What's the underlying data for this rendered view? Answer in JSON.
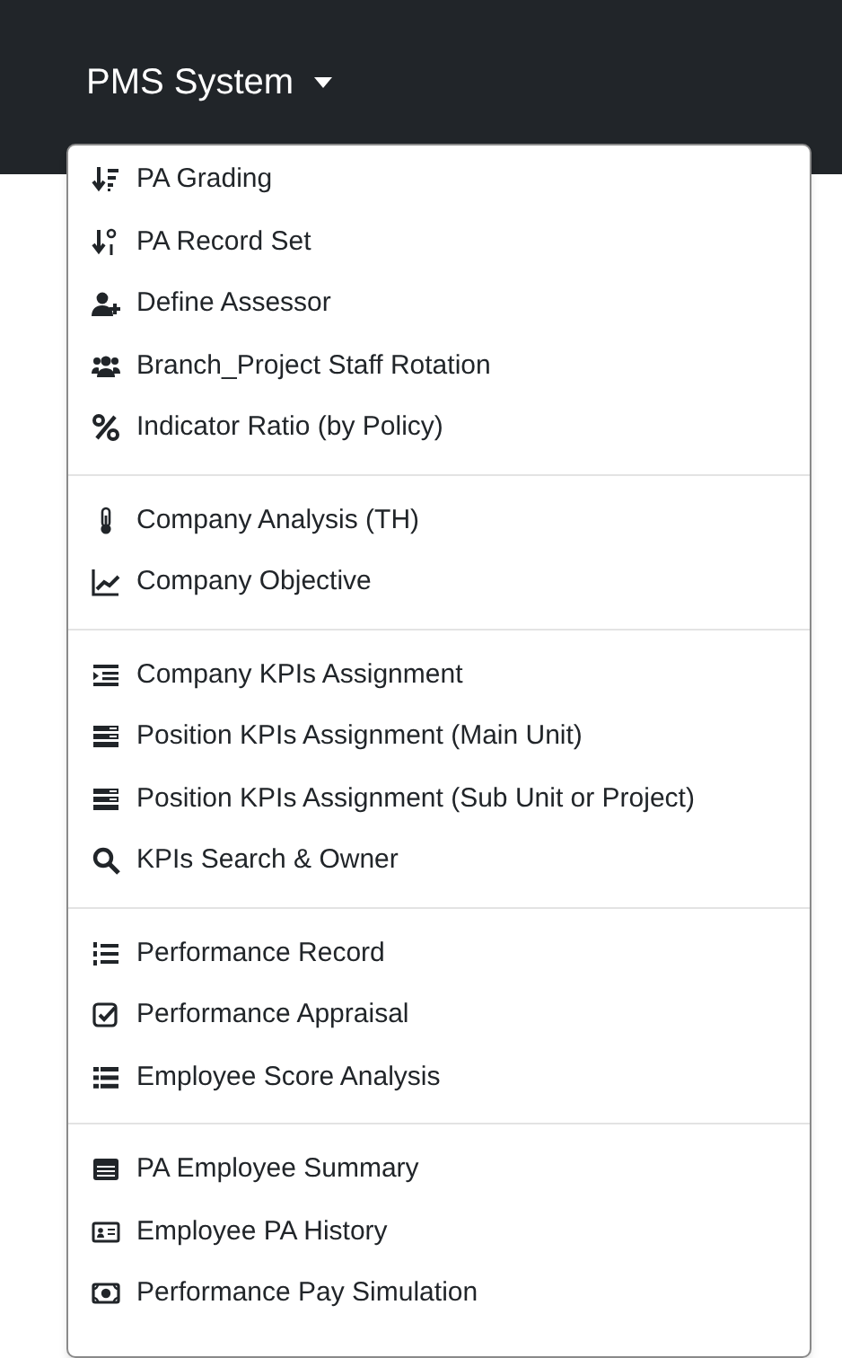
{
  "navbar": {
    "brand": "PMS System"
  },
  "menu": {
    "groups": [
      {
        "items": [
          "PA Grading",
          "PA Record Set",
          "Define Assessor",
          "Branch_Project Staff Rotation",
          "Indicator Ratio (by Policy)"
        ]
      },
      {
        "items": [
          "Company Analysis (TH)",
          "Company Objective"
        ]
      },
      {
        "items": [
          "Company KPIs Assignment",
          "Position KPIs Assignment (Main Unit)",
          "Position KPIs Assignment (Sub Unit or Project)",
          "KPIs Search & Owner"
        ]
      },
      {
        "items": [
          "Performance Record",
          "Performance Appraisal",
          "Employee Score Analysis"
        ]
      },
      {
        "items": [
          "PA Employee Summary",
          "Employee PA History",
          "Performance Pay Simulation"
        ]
      }
    ]
  }
}
